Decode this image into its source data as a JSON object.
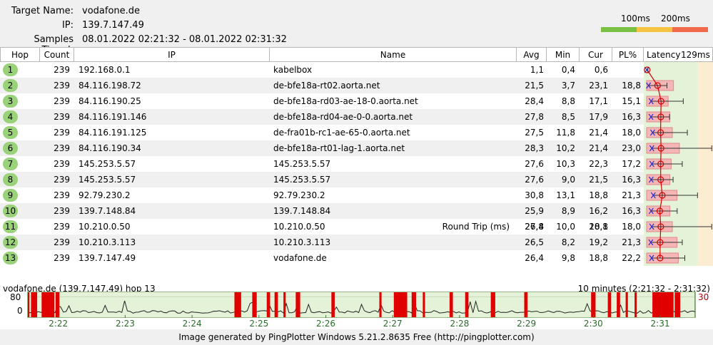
{
  "header": {
    "target_label": "Target Name:",
    "target_value": "vodafone.de",
    "ip_label": "IP:",
    "ip_value": "139.7.147.49",
    "samples_label": "Samples Timed:",
    "samples_value": "08.01.2022 02:21:32 - 08.01.2022 02:31:32",
    "scale_100": "100ms",
    "scale_200": "200ms",
    "scale_colors": [
      "#7ac143",
      "#f6c342",
      "#f26a4b"
    ]
  },
  "columns": {
    "hop": "Hop",
    "count": "Count",
    "ip": "IP",
    "name": "Name",
    "avg": "Avg",
    "min": "Min",
    "cur": "Cur",
    "pl": "PL%",
    "latency": "Latency",
    "latency_max": "129ms"
  },
  "rows": [
    {
      "hop": "1",
      "count": "239",
      "ip": "192.168.0.1",
      "name": "kabelbox",
      "avg": "1,1",
      "min": "0,4",
      "cur": "0,6",
      "pl": ""
    },
    {
      "hop": "2",
      "count": "239",
      "ip": "84.116.198.72",
      "name": "de-bfe18a-rt02.aorta.net",
      "avg": "21,5",
      "min": "3,7",
      "cur": "23,1",
      "pl": "18,8"
    },
    {
      "hop": "3",
      "count": "239",
      "ip": "84.116.190.25",
      "name": "de-bfe18a-rd03-ae-18-0.aorta.net",
      "avg": "28,4",
      "min": "8,8",
      "cur": "17,1",
      "pl": "15,1"
    },
    {
      "hop": "4",
      "count": "239",
      "ip": "84.116.191.146",
      "name": "de-bfe18a-rd04-ae-0-0.aorta.net",
      "avg": "27,8",
      "min": "8,5",
      "cur": "17,9",
      "pl": "16,3"
    },
    {
      "hop": "5",
      "count": "239",
      "ip": "84.116.191.125",
      "name": "de-fra01b-rc1-ae-65-0.aorta.net",
      "avg": "27,5",
      "min": "11,8",
      "cur": "21,4",
      "pl": "18,0"
    },
    {
      "hop": "6",
      "count": "239",
      "ip": "84.116.190.34",
      "name": "de-bfe18a-rt01-lag-1.aorta.net",
      "avg": "28,3",
      "min": "10,2",
      "cur": "21,4",
      "pl": "23,0"
    },
    {
      "hop": "7",
      "count": "239",
      "ip": "145.253.5.57",
      "name": "145.253.5.57",
      "avg": "27,6",
      "min": "10,3",
      "cur": "22,3",
      "pl": "17,2"
    },
    {
      "hop": "8",
      "count": "239",
      "ip": "145.253.5.57",
      "name": "145.253.5.57",
      "avg": "27,6",
      "min": "9,0",
      "cur": "21,5",
      "pl": "16,3"
    },
    {
      "hop": "9",
      "count": "239",
      "ip": "92.79.230.2",
      "name": "92.79.230.2",
      "avg": "30,8",
      "min": "13,1",
      "cur": "18,8",
      "pl": "21,3"
    },
    {
      "hop": "10",
      "count": "239",
      "ip": "139.7.148.84",
      "name": "139.7.148.84",
      "avg": "25,9",
      "min": "8,9",
      "cur": "16,2",
      "pl": "16,3"
    },
    {
      "hop": "11",
      "count": "239",
      "ip": "10.210.0.50",
      "name": "10.210.0.50",
      "avg": "27,8",
      "min": "10,0",
      "cur": "20,1",
      "pl": "18,0"
    },
    {
      "hop": "12",
      "count": "239",
      "ip": "10.210.3.113",
      "name": "10.210.3.113",
      "avg": "26,5",
      "min": "8,2",
      "cur": "19,2",
      "pl": "21,3"
    },
    {
      "hop": "13",
      "count": "239",
      "ip": "139.7.147.49",
      "name": "vodafone.de",
      "avg": "26,4",
      "min": "9,8",
      "cur": "18,8",
      "pl": "22,2"
    }
  ],
  "latency_graph": {
    "max_ms": 129,
    "bars": [
      {
        "avg": 1.1,
        "min": 0.4,
        "cur": 0.6,
        "max": 2.5,
        "pl": 0
      },
      {
        "avg": 21.5,
        "min": 3.7,
        "cur": 23.1,
        "max": 40,
        "pl": 18.8
      },
      {
        "avg": 28.4,
        "min": 8.8,
        "cur": 17.1,
        "max": 72,
        "pl": 15.1
      },
      {
        "avg": 27.8,
        "min": 8.5,
        "cur": 17.9,
        "max": 45,
        "pl": 16.3
      },
      {
        "avg": 27.5,
        "min": 11.8,
        "cur": 21.4,
        "max": 80,
        "pl": 18.0
      },
      {
        "avg": 28.3,
        "min": 10.2,
        "cur": 21.4,
        "max": 128,
        "pl": 23.0
      },
      {
        "avg": 27.6,
        "min": 10.3,
        "cur": 22.3,
        "max": 70,
        "pl": 17.2
      },
      {
        "avg": 27.6,
        "min": 9.0,
        "cur": 21.5,
        "max": 52,
        "pl": 16.3
      },
      {
        "avg": 30.8,
        "min": 13.1,
        "cur": 18.8,
        "max": 100,
        "pl": 21.3
      },
      {
        "avg": 25.9,
        "min": 8.9,
        "cur": 16.2,
        "max": 60,
        "pl": 16.3
      },
      {
        "avg": 27.8,
        "min": 10.0,
        "cur": 20.1,
        "max": 128,
        "pl": 18.0
      },
      {
        "avg": 26.5,
        "min": 8.2,
        "cur": 19.2,
        "max": 70,
        "pl": 21.3
      },
      {
        "avg": 26.4,
        "min": 9.8,
        "cur": 18.8,
        "max": 75,
        "pl": 22.2
      }
    ]
  },
  "round_trip": {
    "label": "Round Trip (ms)",
    "avg": "26,4",
    "cur": "18,8"
  },
  "timeline": {
    "title_left": "vodafone.de (139.7.147.49) hop 13",
    "title_right": "10 minutes (2:21:32 - 2:31:32)",
    "y_top": "80",
    "y_bottom": "0",
    "right_scale": "30",
    "ymax": 100,
    "x_labels": [
      "2:22",
      "2:23",
      "2:24",
      "2:25",
      "2:26",
      "2:27",
      "2:28",
      "2:29",
      "2:30",
      "2:31"
    ],
    "loss_periods_sec": [
      [
        0.0,
        2.0
      ],
      [
        3.5,
        9.0
      ],
      [
        13.0,
        24.5
      ],
      [
        25.5,
        29.0
      ],
      [
        186.0,
        192.0
      ],
      [
        202.0,
        206.0
      ],
      [
        215.0,
        218.0
      ],
      [
        222.0,
        225.0
      ],
      [
        230.0,
        232.0
      ],
      [
        241.0,
        245.0
      ],
      [
        273.0,
        276.0
      ],
      [
        316.0,
        318.0
      ],
      [
        329.0,
        341.0
      ],
      [
        345.0,
        349.0
      ],
      [
        355.0,
        357.0
      ],
      [
        379.0,
        382.0
      ],
      [
        393.0,
        396.0
      ],
      [
        416.0,
        420.0
      ],
      [
        446.0,
        449.0
      ],
      [
        506.0,
        510.0
      ],
      [
        521.0,
        524.0
      ],
      [
        529.0,
        532.0
      ],
      [
        537.0,
        539.0
      ],
      [
        545.0,
        547.0
      ],
      [
        561.0,
        580.0
      ],
      [
        581.0,
        586.0
      ],
      [
        599.0,
        601.0
      ]
    ]
  },
  "footer": "Image generated by PingPlotter Windows 5.21.2.8635 Free (http://pingplotter.com)"
}
